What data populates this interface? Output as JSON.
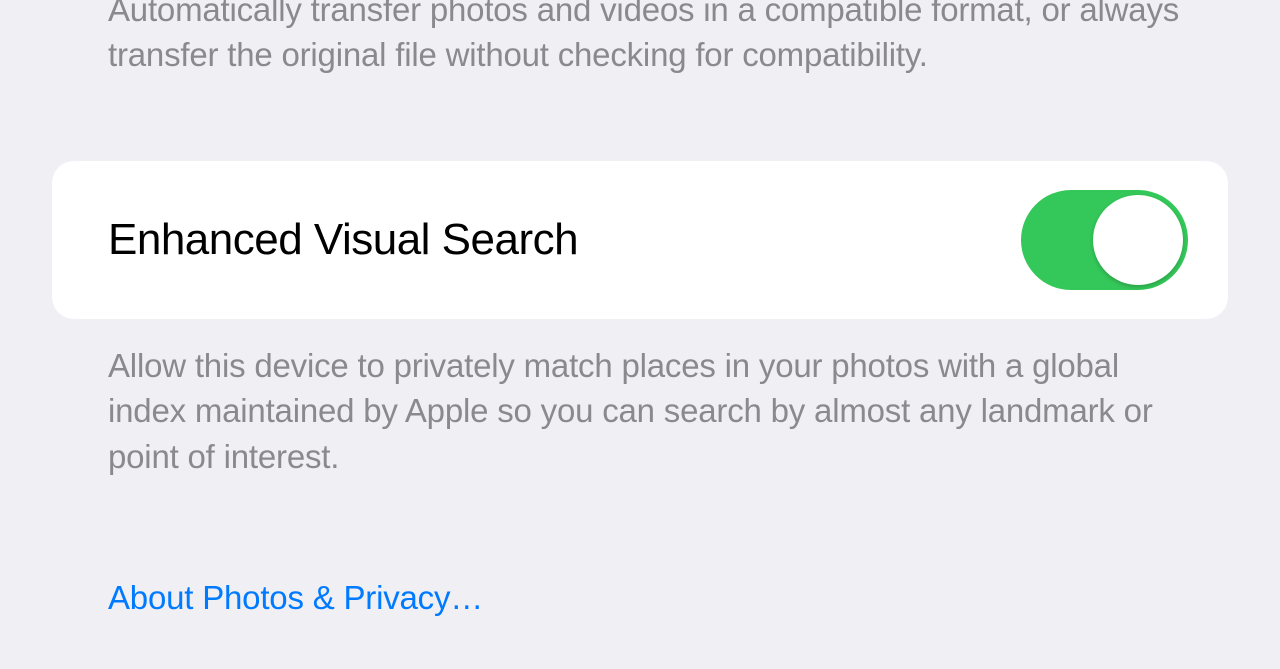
{
  "prev_section": {
    "footer": "Automatically transfer photos and videos in a compatible format, or always transfer the original file without checking for compatibility."
  },
  "evs_section": {
    "title": "Enhanced Visual Search",
    "enabled": true,
    "footer": "Allow this device to privately match places in your photos with a global index maintained by Apple so you can search by almost any landmark or point of interest."
  },
  "privacy_link": {
    "label": "About Photos & Privacy…"
  },
  "colors": {
    "background": "#efeff4",
    "cell_background": "#ffffff",
    "secondary_text": "#8a8a8e",
    "primary_text": "#000000",
    "link": "#007aff",
    "switch_on": "#34c759"
  }
}
